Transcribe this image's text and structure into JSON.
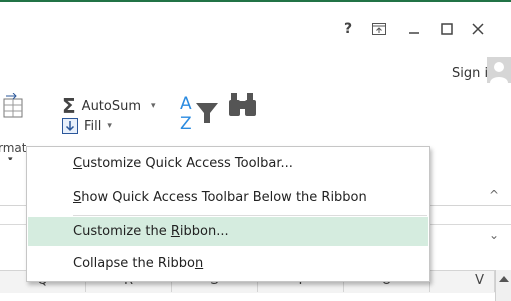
{
  "window": {
    "help_label": "?",
    "signin_label": "Sign in"
  },
  "ribbon": {
    "format_label": "rmat",
    "autosum_label": "AutoSum",
    "fill_label": "Fill",
    "sort_label": "Sort & Filter",
    "find_label": "Find & Select"
  },
  "columns": [
    "Q",
    "R",
    "S",
    "T",
    "U",
    "V"
  ],
  "context_menu": {
    "items": [
      {
        "pre": "",
        "accel": "C",
        "post": "ustomize Quick Access Toolbar..."
      },
      {
        "pre": "",
        "accel": "S",
        "post": "how Quick Access Toolbar Below the Ribbon"
      },
      {
        "pre": "Customize the ",
        "accel": "R",
        "post": "ibbon..."
      },
      {
        "pre": "Collapse the Ribbo",
        "accel": "n",
        "post": ""
      }
    ],
    "highlighted_index": 2
  },
  "colors": {
    "accent_green": "#217346",
    "menu_highlight": "#d5ecdf"
  },
  "icons": [
    "help-icon",
    "ribbon-display-options-icon",
    "minimize-icon",
    "maximize-icon",
    "close-icon",
    "format-icon",
    "sigma-icon",
    "fill-down-icon",
    "sort-filter-icon",
    "binoculars-icon",
    "avatar-icon"
  ]
}
